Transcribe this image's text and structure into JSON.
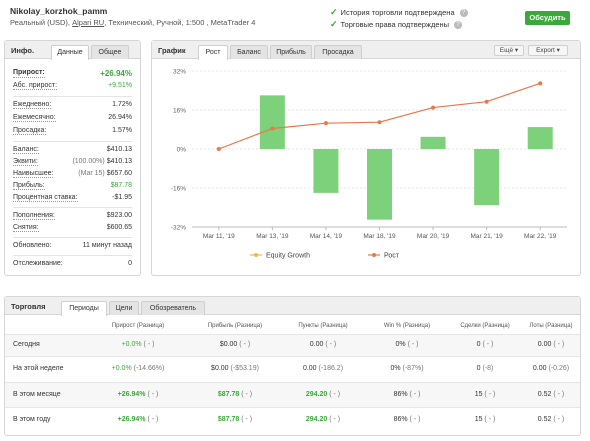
{
  "header": {
    "account_name": "Nikolay_korzhok_pamm",
    "account_type": "Реальный (USD),",
    "broker": "Alpari RU",
    "account_details": ", Технический, Ручной, 1:500 , MetaTrader 4",
    "verify_history": "История торговли подтверждена",
    "verify_rights": "Торговые права подтверждены",
    "discuss_label": "Обсудить"
  },
  "info": {
    "title": "Инфо.",
    "tabs": [
      "Данные",
      "Общее"
    ],
    "rows": {
      "gain_label": "Прирост:",
      "gain_value": "+26.94%",
      "abs_label": "Абс. прирост:",
      "abs_value": "+9.51%",
      "daily_label": "Ежедневно:",
      "daily_value": "1.72%",
      "monthly_label": "Ежемесячно:",
      "monthly_value": "26.94%",
      "drawdown_label": "Просадка:",
      "drawdown_value": "1.57%",
      "balance_label": "Баланс:",
      "balance_value": "$410.13",
      "equity_label": "Эквити:",
      "equity_note": "(100.00%)",
      "equity_value": "$410.13",
      "highest_label": "Наивысшее:",
      "highest_note": "(Mar 15)",
      "highest_value": "$657.60",
      "profit_label": "Прибыль:",
      "profit_value": "$87.78",
      "interest_label": "Процентная ставка:",
      "interest_value": "-$1.95",
      "deposits_label": "Пополнения:",
      "deposits_value": "$923.00",
      "withdrawals_label": "Снятия:",
      "withdrawals_value": "$600.65",
      "updated_label": "Обновлено:",
      "updated_value": "11 минут назад",
      "tracking_label": "Отслеживание:",
      "tracking_value": "0"
    }
  },
  "chart_panel": {
    "title": "График",
    "tabs": [
      "Рост",
      "Баланс",
      "Прибыль",
      "Просадка"
    ],
    "more_label": "Ещё",
    "export_label": "Export"
  },
  "chart_data": {
    "type": "bar",
    "categories": [
      "Mar 11, '19",
      "Mar 13, '19",
      "Mar 14, '19",
      "Mar 18, '19",
      "Mar 20, '19",
      "Mar 21, '19",
      "Mar 22, '19"
    ],
    "series": [
      {
        "name": "Рост",
        "kind": "bar",
        "values": [
          0,
          22,
          -18,
          -29,
          5,
          -23,
          9
        ]
      },
      {
        "name": "Рост",
        "kind": "line",
        "values": [
          0,
          8.4,
          10.6,
          11,
          17,
          19.4,
          26.94
        ]
      }
    ],
    "equity_series_name": "Equity Growth",
    "yticks": [
      "32%",
      "16%",
      "0%",
      "-16%",
      "-32%"
    ],
    "ylim": [
      -32,
      32
    ],
    "grid": true,
    "legend_position": "bottom",
    "colors": {
      "bar": "#7ed17b",
      "line": "#e8774a",
      "equity": "#f5b84a"
    }
  },
  "trade": {
    "title": "Торговля",
    "tabs": [
      "Периоды",
      "Цели",
      "Обозреватель"
    ],
    "headers": [
      "Прирост (Разница)",
      "Прибыль (Разница)",
      "Пункты (Разница)",
      "Win % (Разница)",
      "Сделки (Разница)",
      "Лоты (Разница)"
    ],
    "rows": [
      {
        "period": "Сегодня",
        "gain": "+0.0%",
        "gain_diff": "( - )",
        "profit": "$0.00",
        "profit_diff": "( - )",
        "pips": "0.00",
        "pips_diff": "( - )",
        "win": "0%",
        "win_diff": "( - )",
        "trades": "0",
        "trades_diff": "( - )",
        "lots": "0.00",
        "lots_diff": "( - )"
      },
      {
        "period": "На этой неделе",
        "gain": "+0.0%",
        "gain_diff": "(-14.66%)",
        "profit": "$0.00",
        "profit_diff": "(-$53.19)",
        "pips": "0.00",
        "pips_diff": "(-186.2)",
        "win": "0%",
        "win_diff": "(-87%)",
        "trades": "0",
        "trades_diff": "(-8)",
        "lots": "0.00",
        "lots_diff": "(-0.26)"
      },
      {
        "period": "В этом месяце",
        "gain": "+26.94%",
        "gain_diff": "( - )",
        "profit": "$87.78",
        "profit_diff": "( - )",
        "pips": "294.20",
        "pips_diff": "( - )",
        "win": "86%",
        "win_diff": "( - )",
        "trades": "15",
        "trades_diff": "( - )",
        "lots": "0.52",
        "lots_diff": "( - )"
      },
      {
        "period": "В этом году",
        "gain": "+26.94%",
        "gain_diff": "( - )",
        "profit": "$87.78",
        "profit_diff": "( - )",
        "pips": "294.20",
        "pips_diff": "( - )",
        "win": "86%",
        "win_diff": "( - )",
        "trades": "15",
        "trades_diff": "( - )",
        "lots": "0.52",
        "lots_diff": "( - )"
      }
    ]
  }
}
